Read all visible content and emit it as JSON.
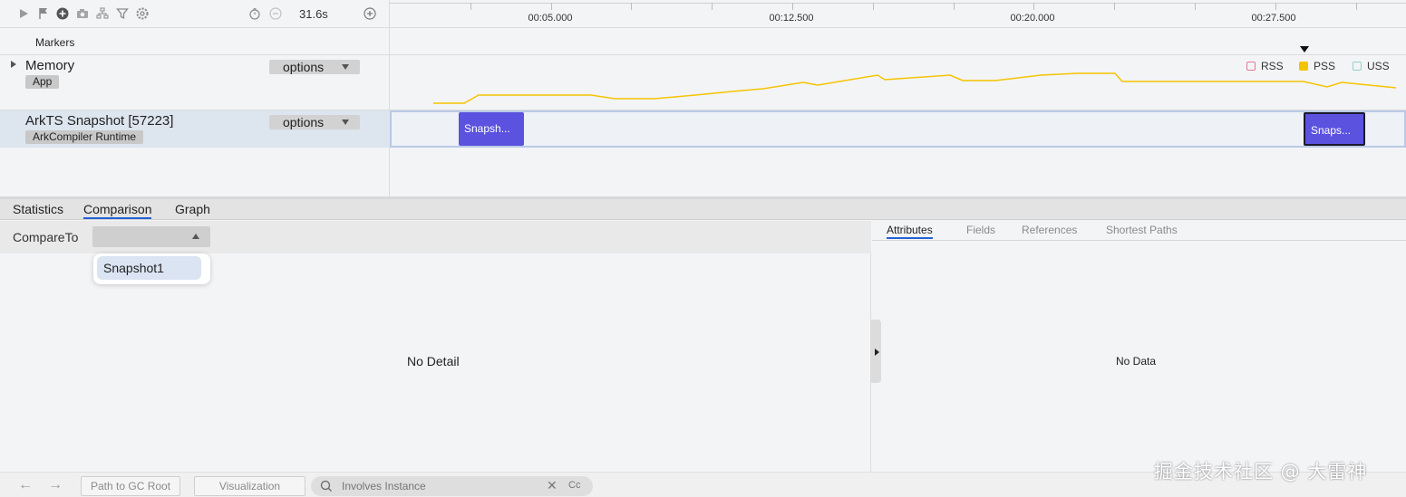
{
  "toolbar": {
    "duration": "31.6s",
    "icons": [
      "play-icon",
      "flag-icon",
      "add-circle-icon",
      "camera-icon",
      "tree-icon",
      "filter-icon",
      "settings-icon",
      "timer-icon",
      "zoom-out-icon",
      "zoom-in-icon"
    ]
  },
  "ruler": {
    "labels": [
      "00:05.000",
      "00:12.500",
      "00:20.000",
      "00:27.500"
    ]
  },
  "rows": {
    "markers": "Markers",
    "memory": {
      "title": "Memory",
      "chip": "App",
      "options": "options"
    },
    "ark": {
      "title": "ArkTS Snapshot [57223]",
      "chip": "ArkCompiler Runtime",
      "options": "options"
    }
  },
  "legend": {
    "rss": {
      "label": "RSS",
      "color": "#e37a8f",
      "checked": false
    },
    "pss": {
      "label": "PSS",
      "color": "#f5c400",
      "checked": true
    },
    "uss": {
      "label": "USS",
      "color": "#8fd3c8",
      "checked": false
    }
  },
  "snapshots": [
    {
      "label": "Snapsh...",
      "selected": false
    },
    {
      "label": "Snaps...",
      "selected": true
    }
  ],
  "bottom_tabs": [
    "Statistics",
    "Comparison",
    "Graph"
  ],
  "active_bottom_tab": "Comparison",
  "compare": {
    "label": "CompareTo",
    "selected": "",
    "options": [
      "Snapshot1"
    ]
  },
  "left_panel": {
    "empty_text": "No Detail"
  },
  "right_tabs": [
    "Attributes",
    "Fields",
    "References",
    "Shortest Paths"
  ],
  "active_right_tab": "Attributes",
  "right_panel": {
    "empty_text": "No Data"
  },
  "footer": {
    "path_button": "Path to GC Root",
    "visualization_button": "Visualization",
    "search_placeholder": "Involves Instance",
    "case_toggle": "Cc",
    "back": "←",
    "forward": "→"
  },
  "watermark": "掘金技术社区 @ 大雷神",
  "colors": {
    "accent": "#2462d6",
    "snapshot": "#5b52e0",
    "pss_line": "#f5c400"
  }
}
